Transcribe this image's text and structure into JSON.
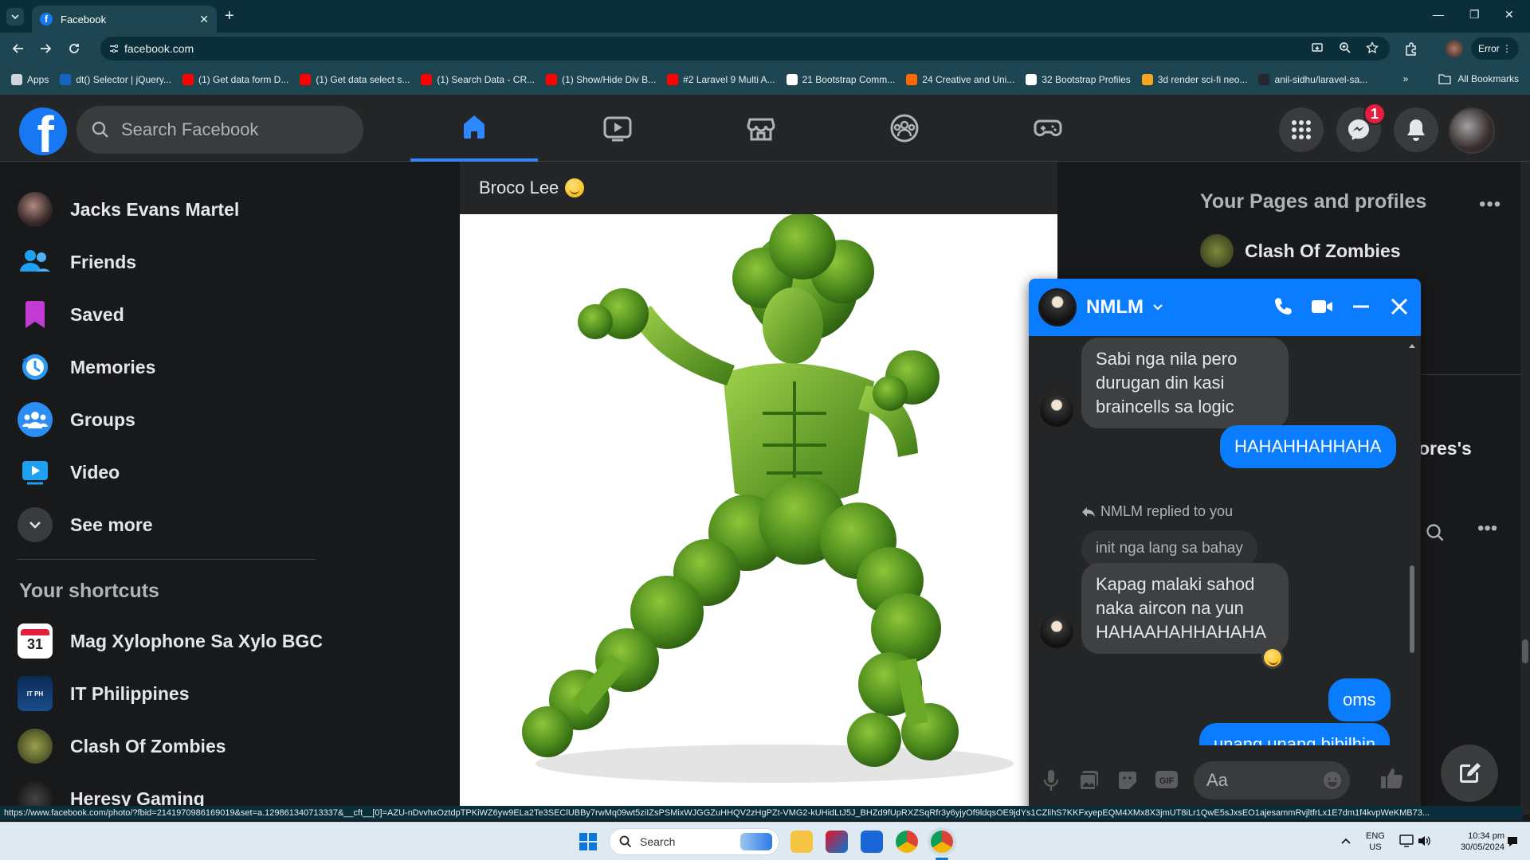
{
  "browser": {
    "tab_title": "Facebook",
    "url": "facebook.com",
    "profile_button": "Error",
    "bookmarks": [
      {
        "label": "Apps",
        "color": "#d0d7dc"
      },
      {
        "label": "dt() Selector | jQuery...",
        "color": "#1565c0"
      },
      {
        "label": "(1) Get data form D...",
        "color": "#ff0000"
      },
      {
        "label": "(1) Get data select s...",
        "color": "#ff0000"
      },
      {
        "label": "(1) Search Data - CR...",
        "color": "#ff0000"
      },
      {
        "label": "(1) Show/Hide Div B...",
        "color": "#ff0000"
      },
      {
        "label": "#2 Laravel 9 Multi A...",
        "color": "#ff0000"
      },
      {
        "label": "21 Bootstrap Comm...",
        "color": "#ffffff"
      },
      {
        "label": "24 Creative and Uni...",
        "color": "#ff6a00"
      },
      {
        "label": "32 Bootstrap Profiles",
        "color": "#ffffff"
      },
      {
        "label": "3d render sci-fi neo...",
        "color": "#f5a623"
      },
      {
        "label": "anil-sidhu/laravel-sa...",
        "color": "#24292e"
      }
    ],
    "all_bookmarks": "All Bookmarks",
    "status_url": "https://www.facebook.com/photo/?fbid=2141970986169019&set=a.129861340713337&__cft__[0]=AZU-nDvvhxOztdpTPKiWZ6yw9ELa2Te3SEClUBBy7rwMq09wt5ziIZsPSMixWJGGZuHHQV2zHgPZt-VMG2-kUHidLtJ5J_BHZd9fUpRXZSqRfr3y6yjyOf9ldqsOE9jdYs1CZlihS7KKFxyepEQM4XMx8X3jmUT8iLr1QwE5sJxsEO1ajesammRvjltfrLx1E7dm1f4kvpWeKMB73..."
  },
  "facebook": {
    "search_placeholder": "Search Facebook",
    "notification_badge": "1",
    "left_nav": [
      {
        "label": "Jacks Evans Martel",
        "icon": "profile-avatar"
      },
      {
        "label": "Friends",
        "icon": "friends-icon"
      },
      {
        "label": "Saved",
        "icon": "saved-icon"
      },
      {
        "label": "Memories",
        "icon": "memories-icon"
      },
      {
        "label": "Groups",
        "icon": "groups-icon"
      },
      {
        "label": "Video",
        "icon": "video-icon"
      },
      {
        "label": "See more",
        "icon": "chevron-down-icon"
      }
    ],
    "shortcuts_heading": "Your shortcuts",
    "shortcuts": [
      {
        "label": "Mag Xylophone Sa Xylo BGC",
        "icon": "calendar-icon"
      },
      {
        "label": "IT Philippines",
        "icon": "group-avatar"
      },
      {
        "label": "Clash Of Zombies",
        "icon": "page-avatar"
      },
      {
        "label": "Heresy Gaming",
        "icon": "page-avatar"
      }
    ],
    "post": {
      "author": "Broco Lee"
    },
    "right_panel": {
      "heading": "Your Pages and profiles",
      "page_name": "Clash Of Zombies",
      "partial_text": "ores's"
    }
  },
  "chat": {
    "name": "NMLM",
    "messages": [
      {
        "from": "them",
        "text": "Sabi nga nila pero durugan din kasi braincells sa logic"
      },
      {
        "from": "me",
        "text": "HAHAHHAHHAHA"
      },
      {
        "from": "system",
        "text": "NMLM replied to you"
      },
      {
        "from": "quote",
        "text": "init nga lang sa bahay"
      },
      {
        "from": "them",
        "text": "Kapag malaki sahod naka aircon na yun HAHAAHAHHAHAHA"
      },
      {
        "from": "me",
        "text": "oms"
      },
      {
        "from": "me",
        "text": "unang unang bibilhin"
      }
    ],
    "input_placeholder": "Aa"
  },
  "taskbar": {
    "search_label": "Search",
    "lang_line1": "ENG",
    "lang_line2": "US",
    "time": "10:34 pm",
    "date": "30/05/2024"
  }
}
